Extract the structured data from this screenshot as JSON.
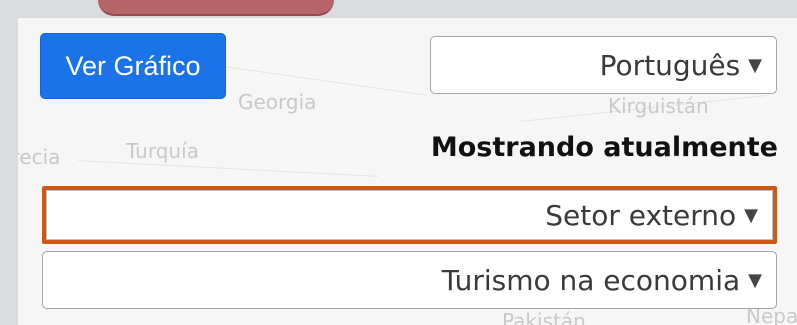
{
  "header": {
    "view_chart_label": "Ver Gráfico"
  },
  "language_select": {
    "value": "Português"
  },
  "heading": {
    "text": "Mostrando atualmente"
  },
  "sector_select": {
    "value": "Setor externo"
  },
  "subsector_select": {
    "value": "Turismo na economia"
  },
  "map_labels": [
    "Georgia",
    "Kirguistán",
    "Grecia",
    "Turquía",
    "Pakistán",
    "Nepal"
  ],
  "colors": {
    "primary_button": "#1a73e8",
    "highlight_border": "#cc5a16",
    "top_accent": "#b66468"
  }
}
